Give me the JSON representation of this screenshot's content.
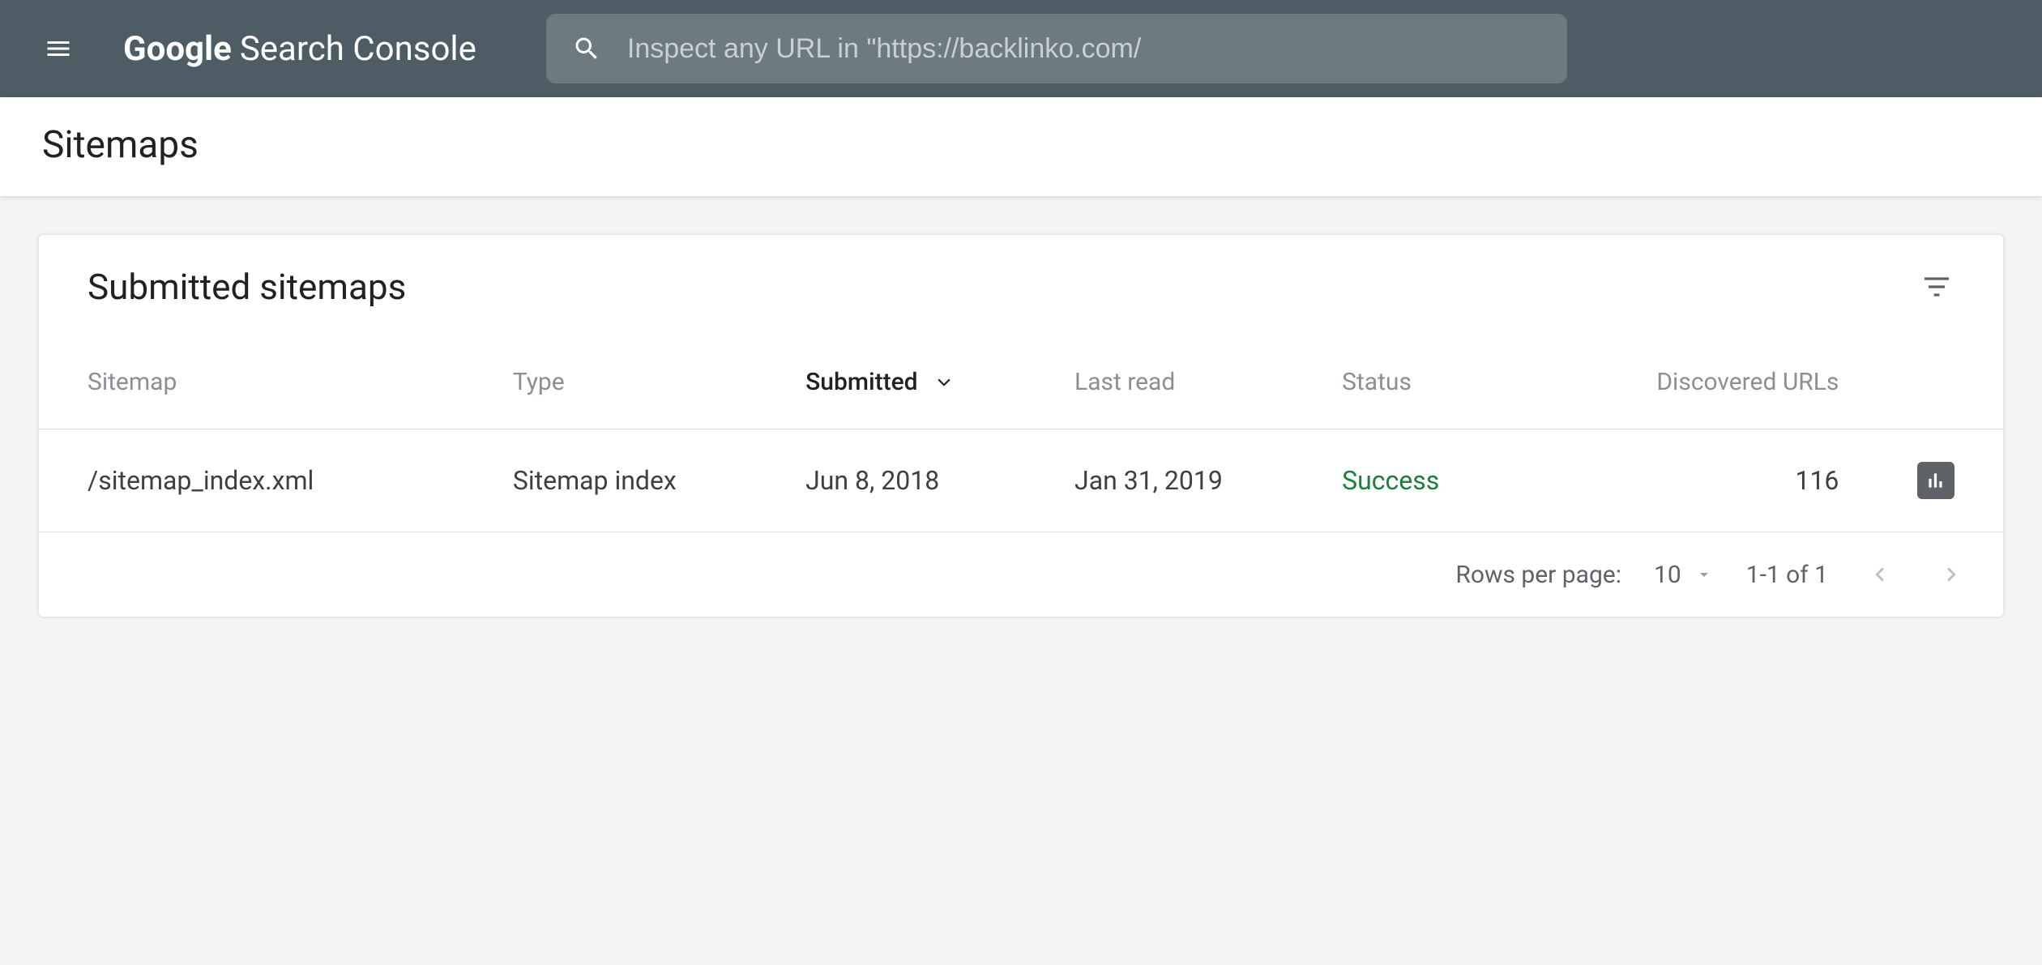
{
  "header": {
    "logo_text_1": "Google",
    "logo_text_2": "Search Console",
    "search_placeholder": "Inspect any URL in \"https://backlinko.com/"
  },
  "page": {
    "title": "Sitemaps"
  },
  "card": {
    "title": "Submitted sitemaps",
    "columns": {
      "sitemap": "Sitemap",
      "type": "Type",
      "submitted": "Submitted",
      "last_read": "Last read",
      "status": "Status",
      "discovered": "Discovered URLs"
    },
    "rows": [
      {
        "sitemap": "/sitemap_index.xml",
        "type": "Sitemap index",
        "submitted": "Jun 8, 2018",
        "last_read": "Jan 31, 2019",
        "status": "Success",
        "discovered": "116"
      }
    ],
    "footer": {
      "rows_per_page_label": "Rows per page:",
      "rows_per_page_value": "10",
      "range": "1-1 of 1"
    }
  }
}
